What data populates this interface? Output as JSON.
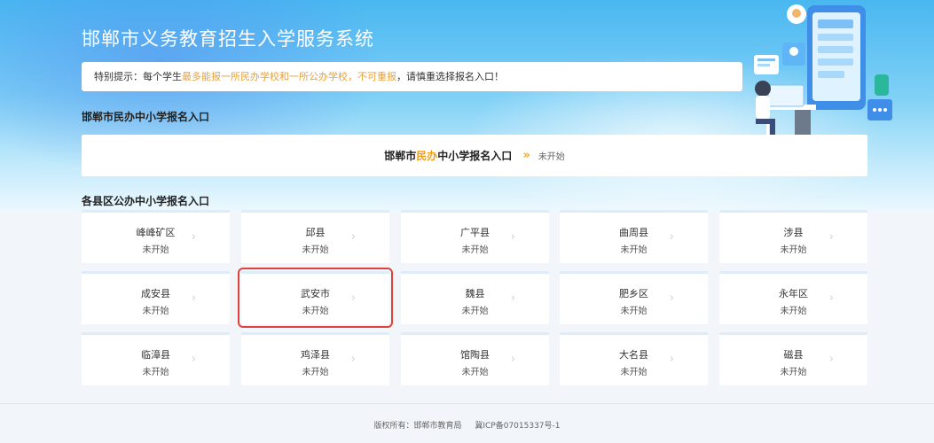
{
  "header": {
    "title": "邯郸市义务教育招生入学服务系统"
  },
  "notice": {
    "prefix": "特别提示：每个学生",
    "highlight": "最多能报一所民办学校和一所公办学校，不可重报",
    "suffix": "，请慎重选择报名入口！"
  },
  "private_section": {
    "title": "邯郸市民办中小学报名入口",
    "entry_prefix": "邯郸市",
    "entry_highlight": "民办",
    "entry_suffix": "中小学报名入口",
    "arrows": "»",
    "status": "未开始"
  },
  "public_section": {
    "title": "各县区公办中小学报名入口",
    "districts": [
      {
        "name": "峰峰矿区",
        "status": "未开始"
      },
      {
        "name": "邱县",
        "status": "未开始"
      },
      {
        "name": "广平县",
        "status": "未开始"
      },
      {
        "name": "曲周县",
        "status": "未开始"
      },
      {
        "name": "涉县",
        "status": "未开始"
      },
      {
        "name": "成安县",
        "status": "未开始"
      },
      {
        "name": "武安市",
        "status": "未开始"
      },
      {
        "name": "魏县",
        "status": "未开始"
      },
      {
        "name": "肥乡区",
        "status": "未开始"
      },
      {
        "name": "永年区",
        "status": "未开始"
      },
      {
        "name": "临漳县",
        "status": "未开始"
      },
      {
        "name": "鸡泽县",
        "status": "未开始"
      },
      {
        "name": "馆陶县",
        "status": "未开始"
      },
      {
        "name": "大名县",
        "status": "未开始"
      },
      {
        "name": "磁县",
        "status": "未开始"
      }
    ]
  },
  "footer": {
    "copyright": "版权所有：邯郸市教育局",
    "icp": "冀ICP备07015337号-1"
  },
  "colors": {
    "accent": "#f39c12",
    "selected_outline": "#e0413a",
    "hero_top": "#49b7f0"
  }
}
